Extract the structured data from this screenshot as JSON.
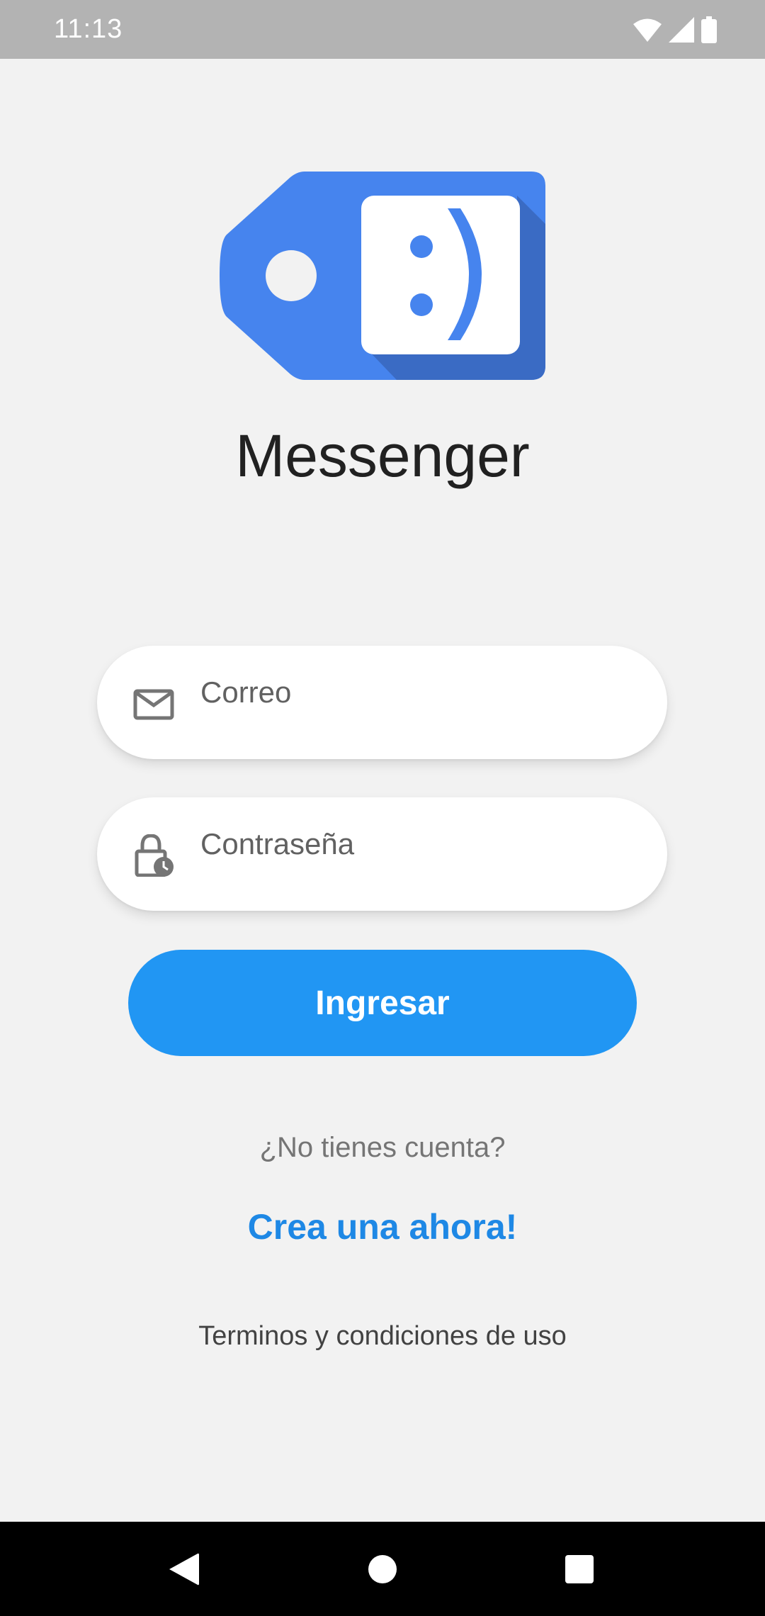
{
  "status_bar": {
    "time": "11:13",
    "icons": [
      "wifi-icon",
      "cell-signal-icon",
      "battery-icon"
    ]
  },
  "app": {
    "title": "Messenger",
    "logo_icon": "tag-smiley-logo",
    "colors": {
      "logo_blue": "#4684ee",
      "logo_shadow": "#3a6bc4",
      "button_blue": "#2196f3",
      "link_blue": "#1e88e5",
      "background": "#f2f2f2"
    }
  },
  "form": {
    "email": {
      "placeholder": "Correo",
      "value": "",
      "icon": "mail-icon"
    },
    "password": {
      "placeholder": "Contraseña",
      "value": "",
      "icon": "lock-clock-icon"
    },
    "login_label": "Ingresar"
  },
  "signup": {
    "prompt": "¿No tienes cuenta?",
    "link_label": "Crea una ahora!"
  },
  "terms_label": "Terminos y condiciones de uso",
  "nav_bar": {
    "buttons": [
      "back-icon",
      "home-icon",
      "recents-icon"
    ]
  }
}
